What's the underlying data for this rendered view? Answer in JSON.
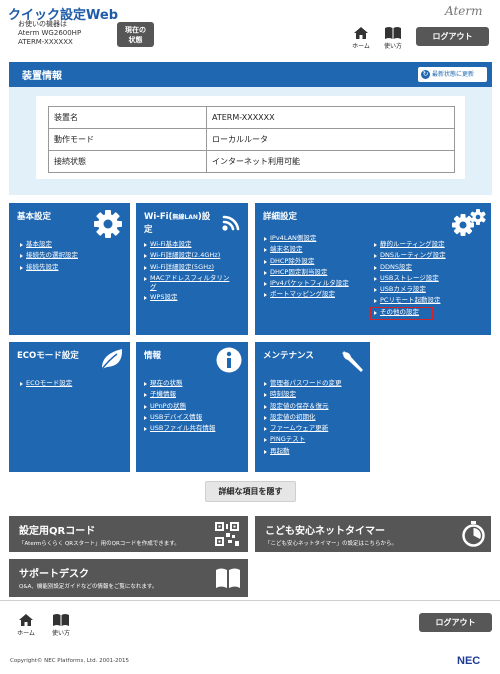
{
  "header": {
    "title": "クイック設定Web",
    "device_label": "お使いの機器は",
    "device_model": "Aterm WG2600HP",
    "device_name": "ATERM-XXXXXX",
    "status_button_line1": "現在の",
    "status_button_line2": "状態",
    "brand": "Aterm",
    "home_label": "ホーム",
    "help_label": "使い方",
    "logout_label": "ログアウト"
  },
  "info": {
    "title": "装置情報",
    "refresh_label": "最新状態に更新",
    "rows": [
      {
        "label": "装置名",
        "value": "ATERM-XXXXXX"
      },
      {
        "label": "動作モード",
        "value": "ローカルルータ"
      },
      {
        "label": "接続状態",
        "value": "インターネット利用可能"
      }
    ]
  },
  "tiles": {
    "basic": {
      "title": "基本設定",
      "links": [
        "基本設定",
        "接続先の選択設定",
        "接続先設定"
      ]
    },
    "wifi": {
      "title_a": "Wi-Fi(",
      "title_small": "無線LAN",
      "title_b": ")設",
      "title_c": "定",
      "links": [
        "Wi-Fi基本設定",
        "Wi-Fi詳細設定(2.4GHz)",
        "Wi-Fi詳細設定(5GHz)",
        "MACアドレスフィルタリン",
        "グ",
        "WPS設定"
      ]
    },
    "advanced": {
      "title": "詳細設定",
      "links_left": [
        "IPv4LAN側設定",
        "端末名設定",
        "DHCP除外設定",
        "DHCP固定割当設定",
        "IPv4パケットフィルタ設定",
        "ポートマッピング設定"
      ],
      "links_right": [
        "静的ルーティング設定",
        "DNSルーティング設定",
        "DDNS設定",
        "USBストレージ設定",
        "USBカメラ設定",
        "PCリモート起動設定",
        "その他の設定"
      ]
    },
    "eco": {
      "title": "ECOモード設定",
      "links": [
        "ECOモード設定"
      ]
    },
    "information": {
      "title": "情報",
      "links": [
        "現在の状態",
        "子機情報",
        "UPnPの状態",
        "USBデバイス情報",
        "USBファイル共有情報"
      ]
    },
    "maintenance": {
      "title": "メンテナンス",
      "links": [
        "管理者パスワードの変更",
        "時刻設定",
        "設定値の保存＆復元",
        "設定値の初期化",
        "ファームウェア更新",
        "PINGテスト",
        "再起動"
      ]
    }
  },
  "hide_button_label": "詳細な項目を隠す",
  "bars": {
    "qr": {
      "title": "設定用QRコード",
      "sub": "「Atermらくらく QRスタート」用のQRコードを作成できます。"
    },
    "timer": {
      "title": "こども安心ネットタイマー",
      "sub": "「こども安心ネットタイマー」の設定はこちらから。"
    },
    "support": {
      "title": "サポートデスク",
      "sub": "Q&A、機能別設定ガイドなどの情報をご覧になれます。"
    }
  },
  "footer": {
    "home_label": "ホーム",
    "help_label": "使い方",
    "logout_label": "ログアウト",
    "copyright": "Copyright© NEC Platforms, Ltd. 2001-2015",
    "nec_logo": "NEC"
  },
  "colors": {
    "accent": "#1f67b1",
    "panel_bg": "#e2f0fa",
    "dark_button": "#565656",
    "highlight": "#d2232a"
  }
}
